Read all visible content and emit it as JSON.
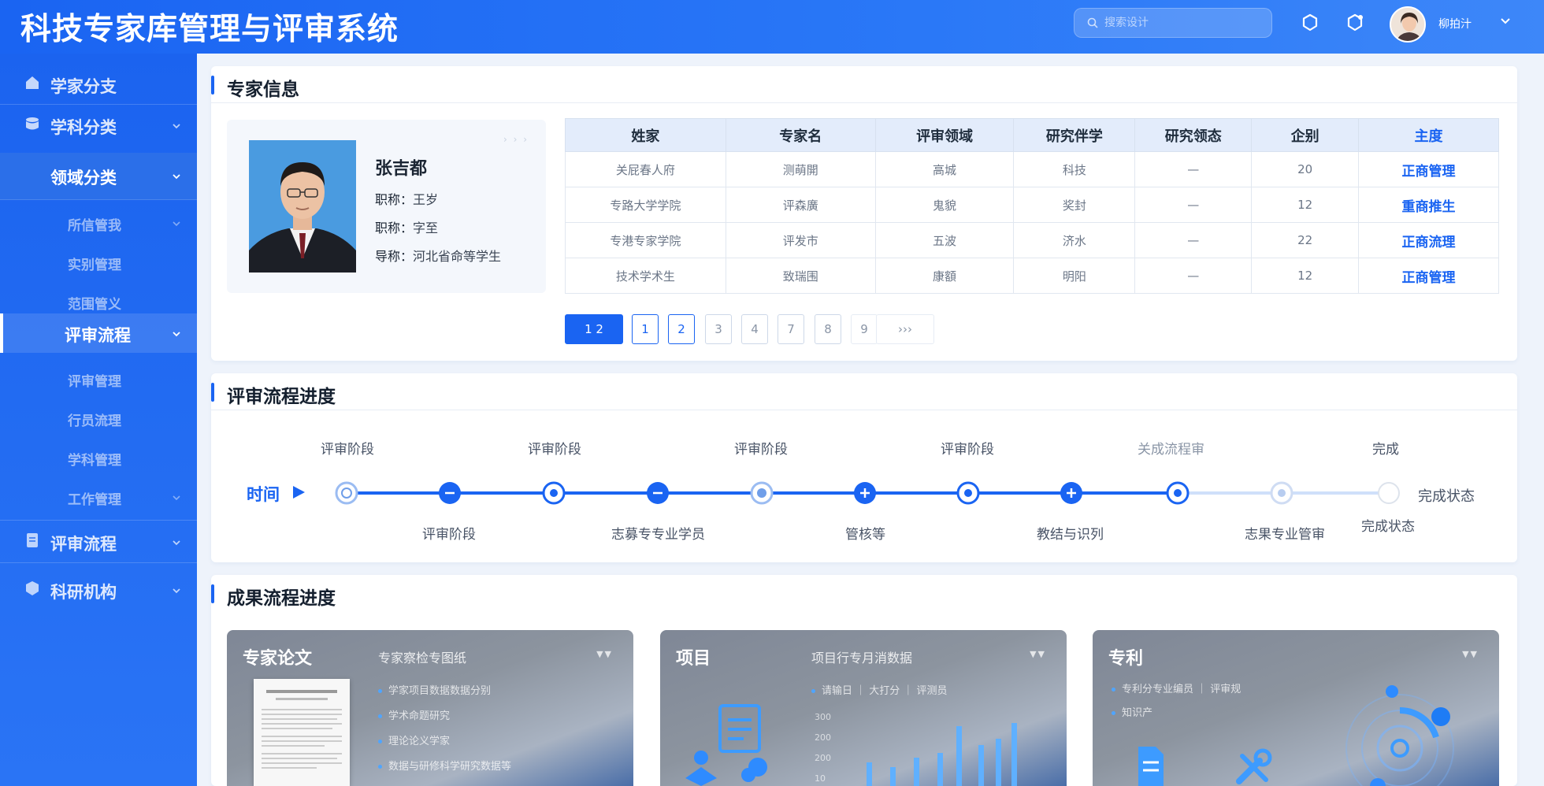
{
  "header": {
    "title": "科技专家库管理与评审系统",
    "search_placeholder": "搜索设计",
    "user_name": "柳拍汁"
  },
  "sidebar": {
    "items": [
      {
        "label": "学家分支",
        "icon": "home-icon"
      },
      {
        "label": "学科分类",
        "icon": "database-icon"
      },
      {
        "label": "领域分类"
      },
      {
        "label": "所信管我"
      },
      {
        "label": "实别管理"
      },
      {
        "label": "范围管义"
      },
      {
        "label": "评审流程"
      },
      {
        "label": "评审管理"
      },
      {
        "label": "行员流理"
      },
      {
        "label": "学科管理"
      },
      {
        "label": "工作管理"
      },
      {
        "label": "评审流程",
        "icon": "document-icon"
      },
      {
        "label": "科研机构",
        "icon": "cube-icon"
      }
    ]
  },
  "expert_info": {
    "title": "专家信息",
    "profile": {
      "name": "张吉都",
      "line1_key": "职称：",
      "line1_val": "王岁",
      "line2_key": "职称：",
      "line2_val": "字至",
      "line3_key": "导称：",
      "line3_val": "河北省命等学生",
      "more": "› › ›"
    },
    "table": {
      "headers": [
        "姓家",
        "专家名",
        "评审领域",
        "研究伴学",
        "研究领态",
        "企别",
        "主度"
      ],
      "rows": [
        [
          "关屁春人府",
          "测萌開",
          "高城",
          "科技",
          "—",
          "20",
          "正商管理"
        ],
        [
          "专路大学学院",
          "评森廣",
          "鬼貌",
          "奖封",
          "—",
          "12",
          "重商推生"
        ],
        [
          "专港专家学院",
          "评发市",
          "五波",
          "济水",
          "—",
          "22",
          "正商流理"
        ],
        [
          "技术学术生",
          "致瑞围",
          "康額",
          "明阳",
          "—",
          "12",
          "正商管理"
        ]
      ]
    },
    "pager": [
      "1 2",
      "1",
      "2",
      "3",
      "4",
      "7",
      "8",
      "9",
      "›››"
    ]
  },
  "review_progress": {
    "title": "评审流程进度",
    "time_label": "时间",
    "top_labels": [
      "评审阶段",
      "评审阶段",
      "评审阶段",
      "评审阶段",
      "关成流程审",
      "完成"
    ],
    "bottom_labels": [
      "评审阶段",
      "志募专专业学员",
      "管核等",
      "教结与识列",
      "志果专业管审",
      "完成状态"
    ],
    "end_label": "完成状态"
  },
  "result_progress": {
    "title": "成果流程进度",
    "cards": [
      {
        "title": "专家论文",
        "subtitle": "专家察检专图纸",
        "bullets": [
          "学家项目数据数据分别",
          "学术命题研究",
          "理论论义学家",
          "数据与研修科学研究数据等"
        ]
      },
      {
        "title": "项目",
        "subtitle": "项目行专月消数据",
        "bullets": [
          "请输日 ｜ 大打分 ｜ 评测员"
        ]
      },
      {
        "title": "专利",
        "subtitle": "",
        "bullets": [
          "专利分专业编员 ｜ 评审规",
          "知识产"
        ]
      }
    ],
    "chart_axis": [
      "300",
      "200",
      "200",
      "10"
    ]
  },
  "colors": {
    "primary": "#1a64f2",
    "sidebar": "#1b63ef",
    "header": "#2a78f7"
  }
}
